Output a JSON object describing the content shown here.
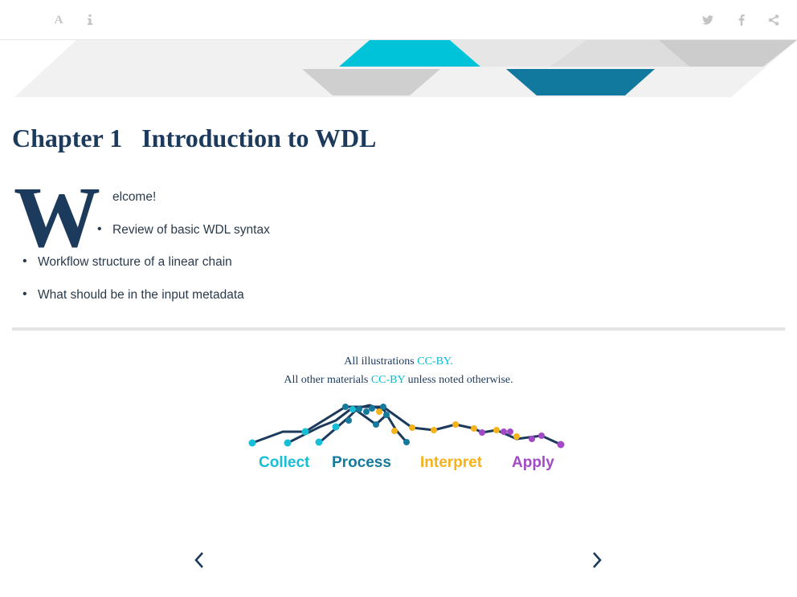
{
  "toolbar": {
    "font_icon_glyph": "A",
    "icons": [
      "font-settings-icon",
      "info-icon",
      "twitter-icon",
      "facebook-icon",
      "share-icon"
    ]
  },
  "chapter": {
    "number": "Chapter 1",
    "title": "Introduction to WDL"
  },
  "intro": {
    "dropcap": "W",
    "rest": "elcome!"
  },
  "bullets": [
    "Review of basic WDL syntax",
    "Workflow structure of a linear chain",
    "What should be in the input metadata"
  ],
  "license": {
    "line1_prefix": "All illustrations ",
    "line1_link": "CC-BY.",
    "line2_prefix": "All other materials ",
    "line2_link": "CC-BY",
    "line2_suffix": " unless noted otherwise."
  },
  "logo": {
    "words": [
      "Collect",
      "Process",
      "Interpret",
      "Apply"
    ],
    "colors": {
      "collect": "#16bfd6",
      "process": "#157a9c",
      "interpret": "#f5b21b",
      "apply": "#a249c6",
      "line": "#1c3a5c"
    }
  },
  "colors": {
    "title": "#1c3a5c",
    "link": "#00bcd4",
    "banner_teal": "#00c2d8",
    "banner_blue": "#12799e",
    "banner_gray": "#cfcfcf"
  },
  "nav": {
    "prev_icon": "chevron-left-icon",
    "next_icon": "chevron-right-icon"
  }
}
